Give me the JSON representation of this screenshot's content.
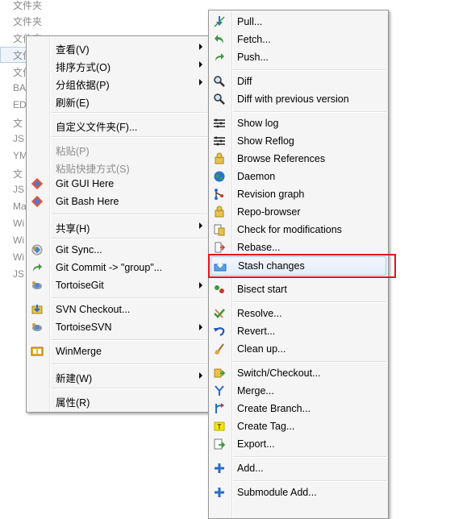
{
  "background": {
    "items": [
      "文件夹",
      "文件夹",
      "文件夹",
      "文件",
      "文件",
      "BA",
      "ED",
      "文",
      "JS",
      "YM",
      "文",
      "JS",
      "Ma",
      "Wi",
      "Wi",
      "Wi",
      "JS"
    ]
  },
  "main_menu": {
    "items": [
      {
        "label": "查看(V)"
      },
      {
        "label": "排序方式(O)"
      },
      {
        "label": "分组依据(P)"
      },
      {
        "label": "刷新(E)"
      },
      {
        "label": "自定义文件夹(F)..."
      },
      {
        "label": "粘贴(P)"
      },
      {
        "label": "粘贴快捷方式(S)"
      },
      {
        "label": "Git GUI Here"
      },
      {
        "label": "Git Bash Here"
      },
      {
        "label": "共享(H)"
      },
      {
        "label": "Git Sync..."
      },
      {
        "label": "Git Commit -> \"group\"..."
      },
      {
        "label": "TortoiseGit"
      },
      {
        "label": "SVN Checkout..."
      },
      {
        "label": "TortoiseSVN"
      },
      {
        "label": "WinMerge"
      },
      {
        "label": "新建(W)"
      },
      {
        "label": "属性(R)"
      }
    ]
  },
  "sub_menu": {
    "items": [
      {
        "label": "Pull..."
      },
      {
        "label": "Fetch..."
      },
      {
        "label": "Push..."
      },
      {
        "label": "Diff"
      },
      {
        "label": "Diff with previous version"
      },
      {
        "label": "Show log"
      },
      {
        "label": "Show Reflog"
      },
      {
        "label": "Browse References"
      },
      {
        "label": "Daemon"
      },
      {
        "label": "Revision graph"
      },
      {
        "label": "Repo-browser"
      },
      {
        "label": "Check for modifications"
      },
      {
        "label": "Rebase..."
      },
      {
        "label": "Stash changes"
      },
      {
        "label": "Bisect start"
      },
      {
        "label": "Resolve..."
      },
      {
        "label": "Revert..."
      },
      {
        "label": "Clean up..."
      },
      {
        "label": "Switch/Checkout..."
      },
      {
        "label": "Merge..."
      },
      {
        "label": "Create Branch..."
      },
      {
        "label": "Create Tag..."
      },
      {
        "label": "Export..."
      },
      {
        "label": "Add..."
      },
      {
        "label": "Submodule Add..."
      }
    ]
  },
  "highlight_color": "#e0141e"
}
